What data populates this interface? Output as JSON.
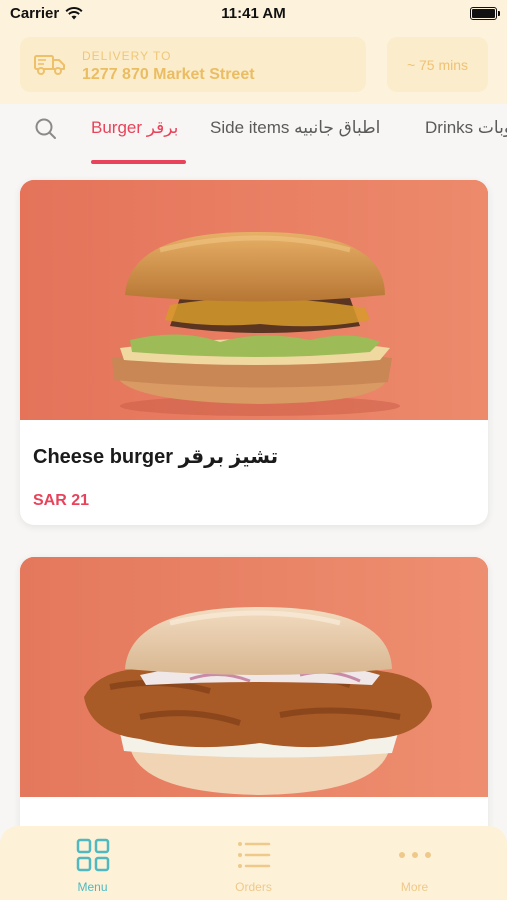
{
  "status": {
    "carrier": "Carrier",
    "time": "11:41 AM"
  },
  "delivery": {
    "label": "DELIVERY TO",
    "address": "1277 870 Market Street",
    "eta": "~ 75 mins"
  },
  "tabs": [
    {
      "label": "Burger برقر",
      "active": true
    },
    {
      "label": "Side items اطباق جانبيه",
      "active": false
    },
    {
      "label": "Drinks مشروبات",
      "active": false
    }
  ],
  "products": [
    {
      "name": "Cheese burger تشيز برقر",
      "price": "SAR 21",
      "image": "cheese-burger-photo"
    },
    {
      "name": "",
      "price": "",
      "image": "fried-chicken-burger-photo"
    }
  ],
  "bottom_nav": [
    {
      "label": "Menu",
      "icon": "grid-icon",
      "active": true
    },
    {
      "label": "Orders",
      "icon": "list-icon",
      "active": false
    },
    {
      "label": "More",
      "icon": "more-dots-icon",
      "active": false
    }
  ],
  "colors": {
    "accent": "#e8435a",
    "header_bg": "#fdf3dc",
    "teal_active": "#4fb9bf",
    "inactive_nav": "#efc98a",
    "image_bg": "#e97f63"
  }
}
